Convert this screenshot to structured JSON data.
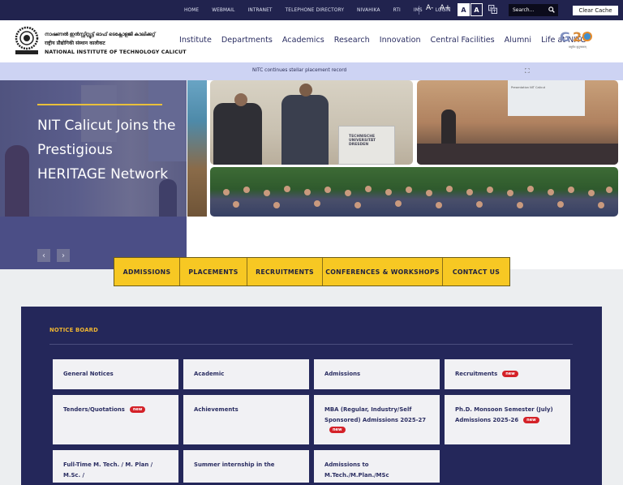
{
  "topbar": {
    "links": [
      "HOME",
      "WEBMAIL",
      "INTRANET",
      "TELEPHONE DIRECTORY",
      "NIVAHIKA",
      "RTI",
      "IMS",
      "LOGIN"
    ],
    "font_decrease": "A-",
    "font_increase": "A+",
    "contrast_light": "A",
    "contrast_dark": "A",
    "search_placeholder": "Search...",
    "clear_cache": "Clear Cache"
  },
  "header": {
    "name_malayalam": "നാഷണൽ ഇൻസ്റ്റിറ്റ്യൂട്ട് ഓഫ് ടെക്നോളജി കാലിക്കറ്റ്",
    "name_hindi": "राष्ट्रीय प्रौद्योगिकी संस्थान कालीकट",
    "name_english": "NATIONAL INSTITUTE OF TECHNOLOGY CALICUT",
    "nav": [
      "Institute",
      "Departments",
      "Academics",
      "Research",
      "Innovation",
      "Central Facilities",
      "Alumni",
      "Life at NITC"
    ],
    "g20": {
      "g": "G",
      "n": "20",
      "tag": "वसुधैव कुटुम्बकम्"
    }
  },
  "ticker": {
    "message": "NITC continues stellar placement record"
  },
  "hero": {
    "title": "NIT Calicut Joins the Prestigious HERITAGE Network",
    "prev": "‹",
    "next": "›",
    "podium_text": "TECHNISCHE UNIVERSITÄT DRESDEN",
    "screen_text": "Presentation NIT Calicut"
  },
  "quick_links": [
    "ADMISSIONS",
    "PLACEMENTS",
    "RECRUITMENTS",
    "CONFERENCES & WORKSHOPS",
    "CONTACT US"
  ],
  "notice_board": {
    "title": "NOTICE BOARD",
    "badge": "new",
    "cards": [
      {
        "label": "General Notices",
        "new": false
      },
      {
        "label": "Academic",
        "new": false
      },
      {
        "label": "Admissions",
        "new": false
      },
      {
        "label": "Recruitments",
        "new": true
      },
      {
        "label": "Tenders/Quotations",
        "new": true
      },
      {
        "label": "Achievements",
        "new": false
      },
      {
        "label": "MBA (Regular, Industry/Self Sponsored) Admissions 2025-27",
        "new": true
      },
      {
        "label": "Ph.D. Monsoon Semester (July) Admissions 2025-26",
        "new": true
      },
      {
        "label": "Full-Time M. Tech. / M. Plan / M.Sc. /",
        "new": false
      },
      {
        "label": "Summer internship in the",
        "new": false
      },
      {
        "label": "Admissions to M.Tech./M.Plan./MSc",
        "new": false
      }
    ]
  }
}
